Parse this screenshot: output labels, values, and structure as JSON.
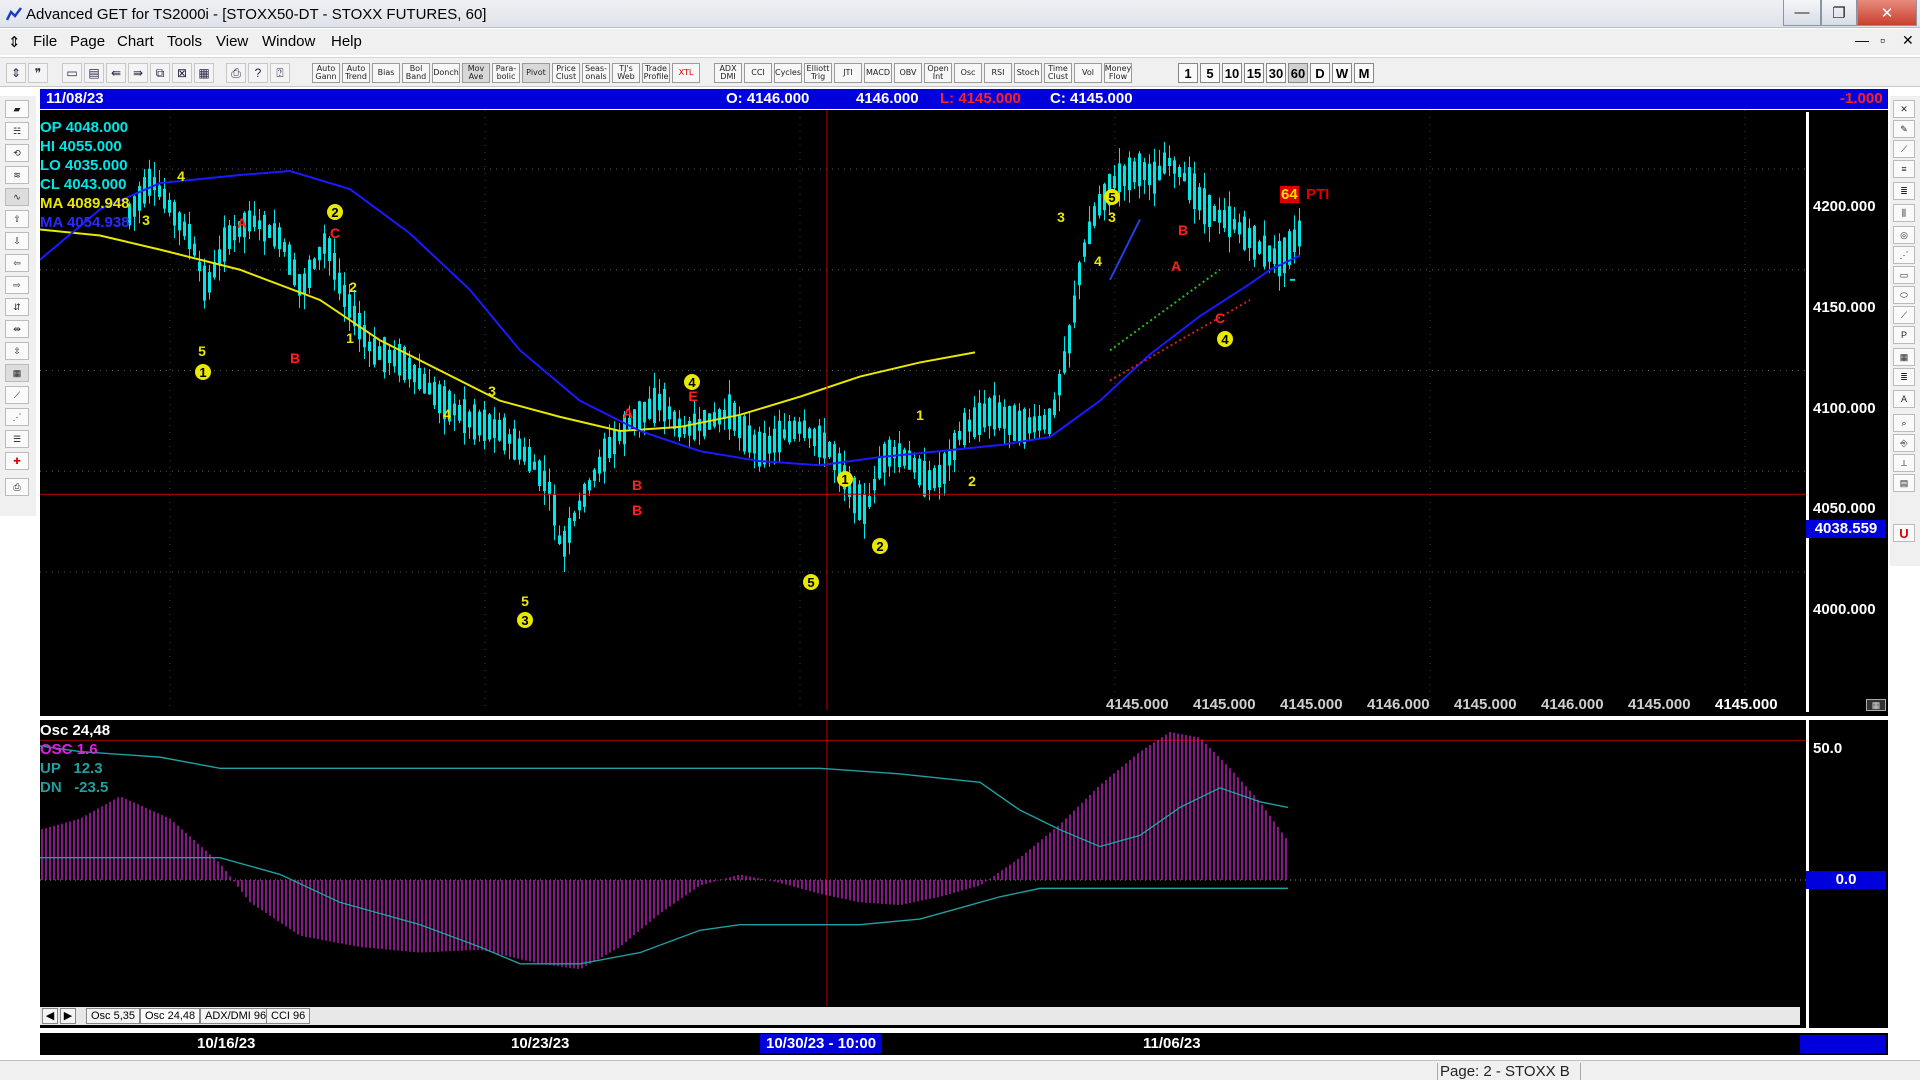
{
  "window": {
    "title": "Advanced GET for TS2000i - [STOXX50-DT - STOXX FUTURES, 60]",
    "minimize": "—",
    "restore": "❐",
    "close": "✕",
    "mdi_min": "—",
    "mdi_restore": "▫",
    "mdi_close": "✕"
  },
  "menu": [
    "File",
    "Page",
    "Chart",
    "Tools",
    "View",
    "Window",
    "Help"
  ],
  "toolbar": {
    "studies": [
      "Auto Gann",
      "Auto Trend",
      "Bias",
      "Bol Band",
      "Donch",
      "Mov Ave",
      "Para- bolic",
      "Pivot",
      "Price Clust",
      "Seas- onals",
      "TJ's Web",
      "Trade Profile",
      "XTL",
      "ADX DMI",
      "CCI",
      "Cycles",
      "Elliott Trig",
      "JTI",
      "MACD",
      "OBV",
      "Open Int",
      "Osc",
      "RSI",
      "Stoch",
      "Time Clust",
      "Vol",
      "Money Flow"
    ],
    "timeframes": [
      "1",
      "5",
      "10",
      "15",
      "30",
      "60",
      "D",
      "W",
      "M"
    ]
  },
  "info_bar": {
    "date": "11/08/23",
    "open": "O: 4146.000",
    "high": "4146.000",
    "low": "L: 4145.000",
    "close": "C: 4145.000",
    "change": "-1.000"
  },
  "price_panel": {
    "readout": [
      {
        "label": "OP",
        "value": "4048.000",
        "color": "#00e5e5"
      },
      {
        "label": "HI",
        "value": "4055.000",
        "color": "#00e5e5"
      },
      {
        "label": "LO",
        "value": "4035.000",
        "color": "#00e5e5"
      },
      {
        "label": "CL",
        "value": "4043.000",
        "color": "#00e5e5"
      },
      {
        "label": "MA",
        "value": "4089.948",
        "color": "#e8e800"
      },
      {
        "label": "MA",
        "value": "4054.938",
        "color": "#2222ff"
      }
    ],
    "y_ticks": [
      "4200.000",
      "4150.000",
      "4100.000",
      "4050.000",
      "4000.000"
    ],
    "crosshair_price": "4038.559",
    "pti_value": "64",
    "pti_label": "PTI",
    "bottom_values": [
      "4145.000",
      "4145.000",
      "4145.000",
      "4146.000",
      "4145.000",
      "4146.000",
      "4145.000",
      "4145.000"
    ],
    "wave_labels": [
      "4",
      "3",
      "5",
      "1",
      "A",
      "B",
      "2",
      "C",
      "2",
      "1",
      "3",
      "4",
      "5",
      "3",
      "A",
      "B",
      "4",
      "E",
      "B",
      "1",
      "5",
      "2",
      "1",
      "2",
      "3",
      "5",
      "3",
      "4",
      "A",
      "B",
      "C",
      "4"
    ],
    "colors": {
      "candles": "#00e5e5",
      "ma_fast": "#e8e800",
      "ma_slow": "#1a1aff",
      "crosshair": "#cc0000"
    }
  },
  "osc_panel": {
    "title": "Osc 24,48",
    "readout": [
      {
        "label": "OSC",
        "value": "1.6",
        "color": "#e020e0"
      },
      {
        "label": "UP",
        "value": "12.3",
        "color": "#20b0b0"
      },
      {
        "label": "DN",
        "value": "-23.5",
        "color": "#20b0b0"
      }
    ],
    "y_ticks": [
      "50.0",
      "0.0"
    ]
  },
  "tabs": [
    "Osc 5,35",
    "Osc 24,48",
    "ADX/DMI 96",
    "CCI 96"
  ],
  "date_axis": [
    "10/16/23",
    "10/23/23",
    "10/30/23 - 10:00",
    "11/06/23"
  ],
  "status": "Page: 2 - STOXX B"
}
